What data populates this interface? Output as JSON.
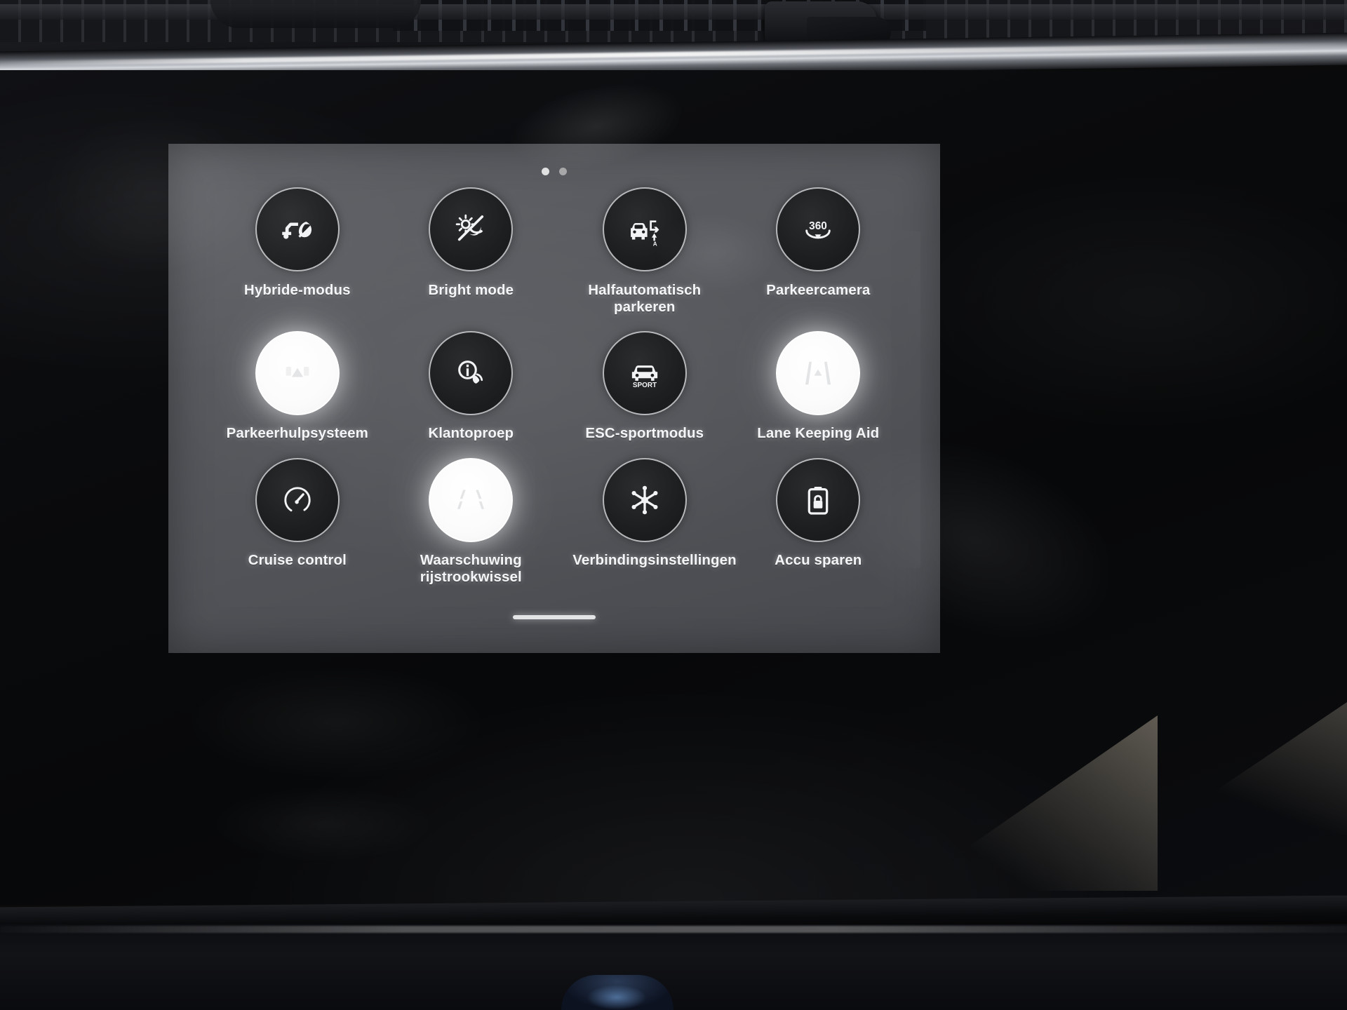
{
  "screen": {
    "title": "Vehicle quick settings",
    "pagination": {
      "total_dots": 2,
      "active_index": 0
    },
    "home_indicator": true
  },
  "tiles": [
    {
      "label": "Hybride-modus",
      "icon": "car-leaf-icon",
      "active": false
    },
    {
      "label": "Bright mode",
      "icon": "sun-moon-slash-icon",
      "active": false
    },
    {
      "label": "Halfautomatisch parkeren",
      "icon": "semi-auto-parking-icon",
      "active": false
    },
    {
      "label": "Parkeercamera",
      "icon": "camera-360-icon",
      "active": false
    },
    {
      "label": "Parkeerhulpsysteem",
      "icon": "park-assist-car-icon",
      "active": true
    },
    {
      "label": "Klantoproep",
      "icon": "info-phone-icon",
      "active": false
    },
    {
      "label": "ESC-sportmodus",
      "icon": "car-sport-icon",
      "active": false
    },
    {
      "label": "Lane Keeping Aid",
      "icon": "lane-keeping-icon",
      "active": true
    },
    {
      "label": "Cruise control",
      "icon": "speedometer-icon",
      "active": false
    },
    {
      "label": "Waarschuwing rijstrookwissel",
      "icon": "lane-change-warning-icon",
      "active": true
    },
    {
      "label": "Verbindingsinstellingen",
      "icon": "connection-node-icon",
      "active": false
    },
    {
      "label": "Accu sparen",
      "icon": "battery-lock-icon",
      "active": false
    }
  ],
  "colors": {
    "tile_inactive_bg": "#1d1e20",
    "tile_active_bg": "#ffffff",
    "tile_border": "#e1e3e6",
    "label_text": "#f4f5f6",
    "panel_bg": "#55575c"
  }
}
